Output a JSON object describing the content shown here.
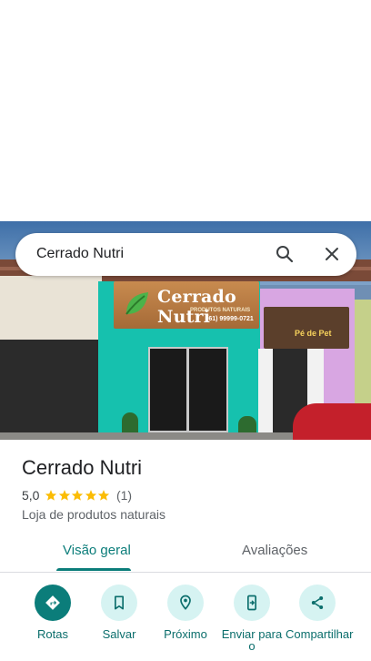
{
  "search": {
    "query": "Cerrado Nutri"
  },
  "photo": {
    "sign_text": "Cerrado Nutri",
    "sign_sub": "PRODUTOS NATURAIS",
    "sign_phone": "(61) 99999-0721",
    "neighbor_sign": "Pé de Pet"
  },
  "place": {
    "name": "Cerrado Nutri",
    "rating": "5,0",
    "review_count": "(1)",
    "stars": 5,
    "category": "Loja de produtos naturais"
  },
  "tabs": {
    "overview": "Visão geral",
    "reviews": "Avaliações"
  },
  "actions": {
    "routes": "Rotas",
    "save": "Salvar",
    "nearby": "Próximo",
    "send": "Enviar para o",
    "share": "Compartilhar"
  },
  "colors": {
    "accent": "#0b7d7a",
    "accent_light": "#d6f3f2",
    "star": "#fbbc04"
  }
}
